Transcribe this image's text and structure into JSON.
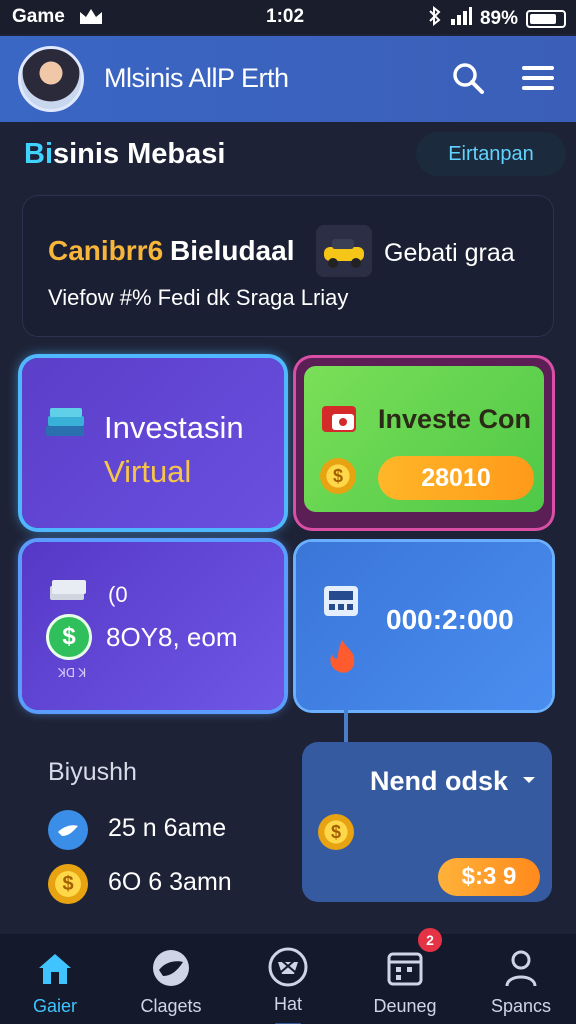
{
  "status": {
    "left": "Game",
    "time": "1:02",
    "battery": "89%"
  },
  "header": {
    "title": "Mlsinis AllP Erth"
  },
  "section": {
    "title_a": "Bi",
    "title_b": "sinis Mebasi",
    "button": "Eirtanpan"
  },
  "banner": {
    "brand": "Canibrr6",
    "title": "Bieludaal",
    "right": "Gebati graa",
    "sub": "Viefow  #%  Fedi dk Sraga Lriay"
  },
  "card_virtual": {
    "line1": "Investasin",
    "line2": "Virtual"
  },
  "card_coin": {
    "title": "Investe Con",
    "value": "28010"
  },
  "card_balance": {
    "small": "(0",
    "value": "8OY8, eom",
    "tiny": "ꓘꓷ ꓘ"
  },
  "card_time": {
    "value": "000:2:000"
  },
  "left_list": {
    "title": "Biyushh",
    "row1": "25 n 6ame",
    "row2": "6O 6 3amn"
  },
  "card_next": {
    "title": "Nend odsk",
    "price": "$:3 9"
  },
  "nav": {
    "items": [
      "Gaier",
      "Clagets",
      "Hat",
      "Deuneg",
      "Spancs"
    ],
    "badge": "2"
  },
  "colors": {
    "accent": "#3fd3ff",
    "header": "#3a66c4",
    "gold": "#f7b53a"
  }
}
